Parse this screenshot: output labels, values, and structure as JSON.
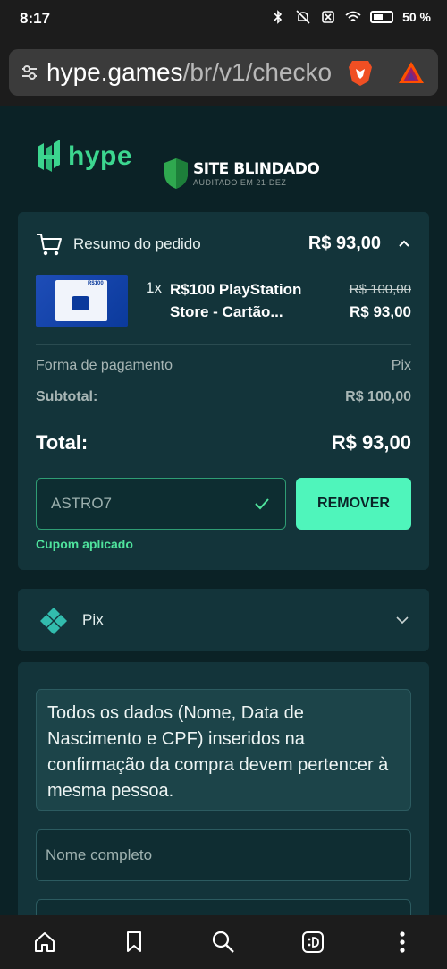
{
  "status_bar": {
    "time": "8:17",
    "battery": "50 %"
  },
  "browser": {
    "url_main": "hype.games",
    "url_rest": "/br/v1/checko"
  },
  "header": {
    "logo_text": "hype",
    "badge_title": "SITE BLINDADO",
    "badge_subtitle": "AUDITADO EM 21-DEZ"
  },
  "summary": {
    "title": "Resumo do pedido",
    "header_total": "R$ 93,00",
    "product": {
      "qty": "1x",
      "name": "R$100 PlayStation Store - Cartão...",
      "old_price": "R$ 100,00",
      "new_price": "R$ 93,00",
      "image_tag": "R$100"
    },
    "payment_label": "Forma de pagamento",
    "payment_value": "Pix",
    "subtotal_label": "Subtotal:",
    "subtotal_value": "R$ 100,00",
    "total_label": "Total:",
    "total_value": "R$ 93,00",
    "coupon_code": "ASTRO7",
    "remove_label": "REMOVER",
    "coupon_status": "Cupom aplicado"
  },
  "payment_method": {
    "label": "Pix"
  },
  "form": {
    "notice": "Todos os dados (Nome, Data de Nascimento e CPF) inseridos na confirmação da compra devem pertencer à mesma pessoa.",
    "name_placeholder": "Nome completo"
  },
  "colors": {
    "accent": "#4ff5bb",
    "brand_green": "#3cd68f",
    "background": "#0b2226",
    "card": "#13343a"
  },
  "icons": [
    "tune-icon",
    "brave-icon",
    "bat-icon",
    "cart-icon",
    "chevron-up-icon",
    "check-icon",
    "pix-icon",
    "chevron-down-icon",
    "home-icon",
    "bookmark-icon",
    "search-icon",
    "tabs-icon",
    "more-icon"
  ]
}
